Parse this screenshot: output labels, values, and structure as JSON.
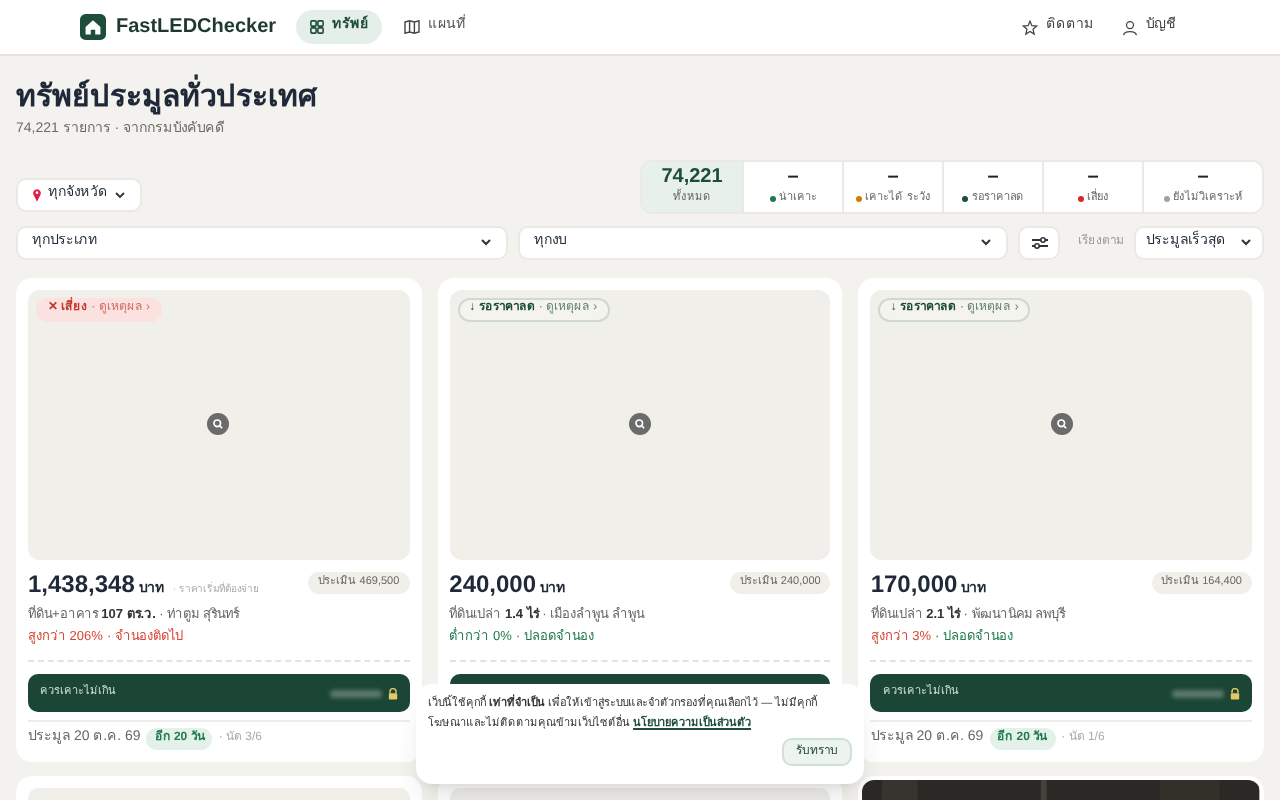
{
  "header": {
    "brand": "FastLEDChecker",
    "nav": [
      {
        "label": "ทรัพย์",
        "selected": true
      },
      {
        "label": "แผนที่",
        "selected": false
      }
    ],
    "actions": [
      {
        "label": "ติดตาม"
      },
      {
        "label": "บัญชี"
      }
    ]
  },
  "title": "ทรัพย์ประมูลทั่วประเทศ",
  "subtitle": "74,221 รายการ · จากกรมบังคับคดี",
  "province": "ทุกจังหวัด",
  "stats": [
    {
      "value": "74,221",
      "label": "ทั้งหมด",
      "selected": true
    },
    {
      "value": "–",
      "label": "น่าเคาะ",
      "color": "#1f7a4d",
      "selected": false
    },
    {
      "value": "–",
      "label": "เคาะได้ ระวัง",
      "color": "#d97706",
      "selected": false
    },
    {
      "value": "–",
      "label": "รอราคาลด",
      "color": "#1e4d3a",
      "selected": false
    },
    {
      "value": "–",
      "label": "เสี่ยง",
      "color": "#dc2626",
      "selected": false
    },
    {
      "value": "–",
      "label": "ยังไม่วิเคราะห์",
      "color": "#9ca3af",
      "selected": false
    }
  ],
  "filters": {
    "type": "ทุกประเภท",
    "budget": "ทุกงบ",
    "sort_label": "เรียงตาม",
    "sort": "ประมูลเร็วสุด"
  },
  "cards": [
    {
      "kind": "risk",
      "badge": "✕ เสี่ยง",
      "badge_link": "· ดูเหตุผล ›",
      "price": "1,438,348",
      "unit": "บาท",
      "price_note": "· ราคาเริ่มที่ต้องจ่าย",
      "appraisal": "ประเมิน 469,500",
      "detail_pre": "ที่ดิน+อาคาร ",
      "size": "107 ตร.ว.",
      "location": " · ท่าตูม สุรินทร์",
      "diff": "สูงกว่า 206%",
      "above_appraisal": true,
      "mortgage": "· จำนองติดไป",
      "mortgage_ok": false,
      "max_bid_label": "ควรเคาะไม่เกิน",
      "auction_date": "ประมูล 20 ต.ค. 69",
      "countdown": "อีก 20 วัน",
      "round": "· นัด 3/6"
    },
    {
      "kind": "wait",
      "badge": "↓ รอราคาลด",
      "badge_link": "· ดูเหตุผล ›",
      "price": "240,000",
      "unit": "บาท",
      "appraisal": "ประเมิน 240,000",
      "detail_pre": "ที่ดินเปล่า ",
      "size": "1.4 ไร่",
      "location": " · เมืองลำพูน ลำพูน",
      "diff": "ต่ำกว่า 0%",
      "above_appraisal": false,
      "mortgage": "· ปลอดจำนอง",
      "mortgage_ok": true
    },
    {
      "kind": "wait",
      "badge": "↓ รอราคาลด",
      "badge_link": "· ดูเหตุผล ›",
      "price": "170,000",
      "unit": "บาท",
      "appraisal": "ประเมิน 164,400",
      "detail_pre": "ที่ดินเปล่า ",
      "size": "2.1 ไร่",
      "location": " · พัฒนานิคม ลพบุรี",
      "diff": "สูงกว่า 3%",
      "above_appraisal": true,
      "mortgage": "· ปลอดจำนอง",
      "mortgage_ok": true,
      "max_bid_label": "ควรเคาะไม่เกิน",
      "auction_date": "ประมูล 20 ต.ค. 69",
      "countdown": "อีก 20 วัน",
      "round": "· นัด 1/6"
    }
  ],
  "cookie_banner": {
    "text": "เว็บนี้ใช้คุกกี้ **เท่าที่จำเป็น** เพื่อให้เข้าสู่ระบบและจำตัวกรองที่คุณเลือกไว้ — ไม่มีคุกกี้โฆษณาและไม่ติดตามคุณข้ามเว็บไซต์อื่น",
    "link": "นโยบายความเป็นส่วนตัว",
    "button": "รับทราบ"
  }
}
